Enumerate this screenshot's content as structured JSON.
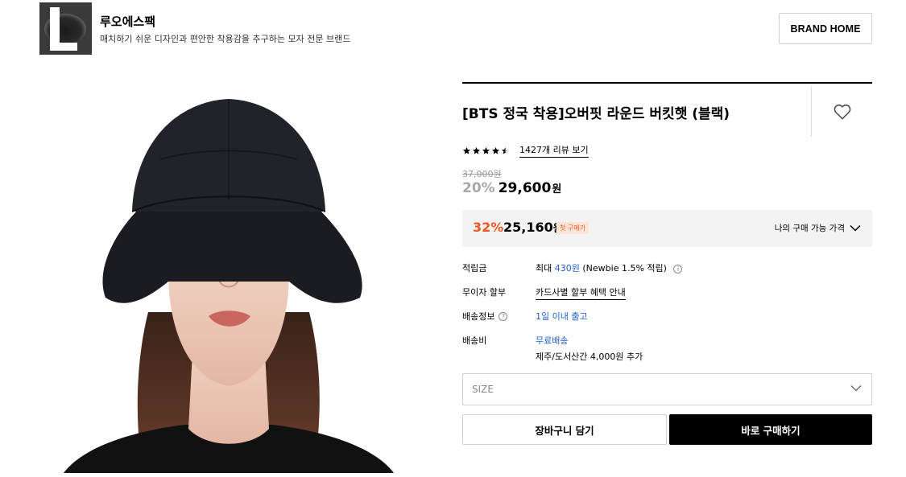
{
  "brand": {
    "logo_icon": "brand-logo-L",
    "name": "루오에스팩",
    "description": "매치하기 쉬운 디자인과 편안한 착용감을 추구하는 모자 전문 브랜드",
    "home_button": "BRAND HOME"
  },
  "product": {
    "image_icon": "product-photo-bucket-hat",
    "title": "[BTS 정국 착용]오버핏 라운드 버킷햇 (블랙)",
    "rating": 4.5,
    "review_link": "1427개 리뷰 보기",
    "original_price": "37,000원",
    "discount_rate": "20%",
    "sale_price": "29,600",
    "sale_unit": "원"
  },
  "member_price": {
    "rate": "32%",
    "price": "25,160",
    "unit": "원",
    "badge": "첫 구매가",
    "toggle_label": "나의 구매 가능 가격"
  },
  "info": {
    "points_label": "적립금",
    "points_prefix": "최대",
    "points_value": "430원",
    "points_suffix": "(Newbie 1.5% 적립)",
    "installment_label": "무이자 할부",
    "installment_value": "카드사별 할부 혜택 안내",
    "shipping_info_label": "배송정보",
    "shipping_info_value": "1일 이내 출고",
    "shipping_fee_label": "배송비",
    "shipping_fee_value": "무료배송",
    "shipping_fee_extra": "제주/도서산간 4,000원 추가"
  },
  "options": {
    "size_placeholder": "SIZE"
  },
  "actions": {
    "cart": "장바구니 담기",
    "buy": "바로 구매하기"
  },
  "colors": {
    "accent_orange": "#f0561f",
    "link_blue": "#1f5fd1",
    "primary_black": "#000000"
  }
}
